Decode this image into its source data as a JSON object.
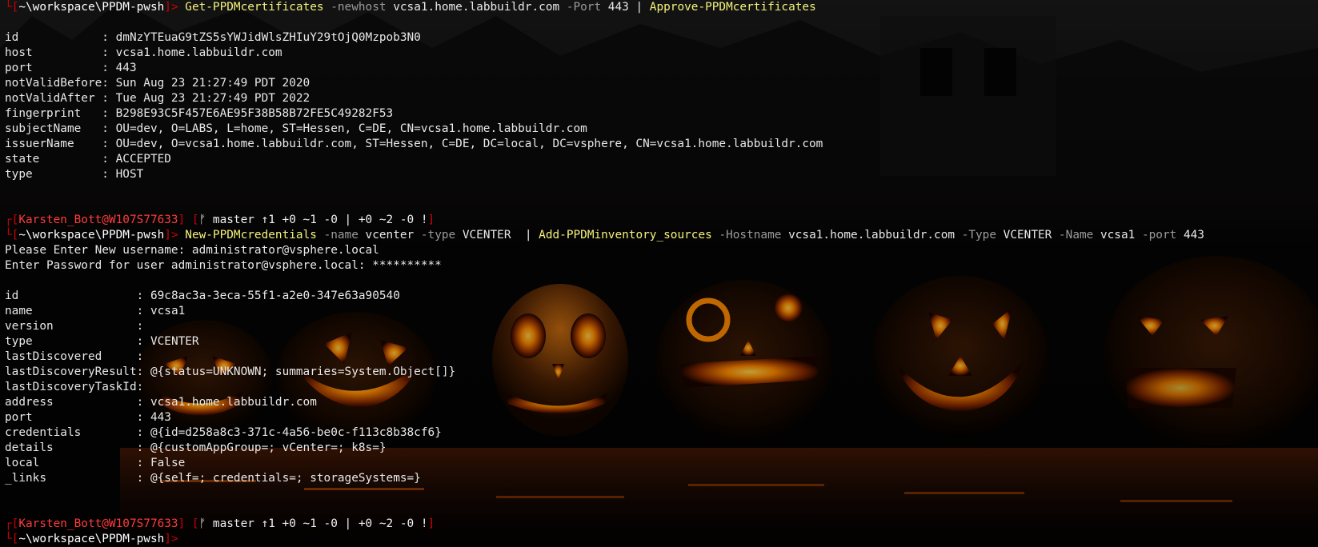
{
  "blocks": [
    {
      "prompt_path": "~\\workspace\\PPDM-pwsh",
      "command": [
        {
          "t": "cmd",
          "v": "Get-PPDMcertificates"
        },
        {
          "t": "param",
          "v": " -newhost"
        },
        {
          "t": "arg",
          "v": " vcsa1.home.labbuildr.com"
        },
        {
          "t": "param",
          "v": " -Port"
        },
        {
          "t": "arg",
          "v": " 443"
        },
        {
          "t": "pipe",
          "v": " | "
        },
        {
          "t": "cmd",
          "v": "Approve-PPDMcertificates"
        }
      ],
      "output": [],
      "props": [
        [
          "id",
          "dmNzYTEuaG9tZS5sYWJidWlsZHIuY29tOjQ0Mzpob3N0"
        ],
        [
          "host",
          "vcsa1.home.labbuildr.com"
        ],
        [
          "port",
          "443"
        ],
        [
          "notValidBefore",
          "Sun Aug 23 21:27:49 PDT 2020"
        ],
        [
          "notValidAfter",
          "Tue Aug 23 21:27:49 PDT 2022"
        ],
        [
          "fingerprint",
          "B298E93C5F457E6AE95F38B58B72FE5C49282F53"
        ],
        [
          "subjectName",
          "OU=dev, O=LABS, L=home, ST=Hessen, C=DE, CN=vcsa1.home.labbuildr.com"
        ],
        [
          "issuerName",
          "OU=dev, O=vcsa1.home.labbuildr.com, ST=Hessen, C=DE, DC=local, DC=vsphere, CN=vcsa1.home.labbuildr.com"
        ],
        [
          "state",
          "ACCEPTED"
        ],
        [
          "type",
          "HOST"
        ]
      ],
      "key_width": 14
    },
    {
      "user_host": "Karsten_Bott@W107S77633",
      "git": "ᚠ master ↑1 +0 ~1 -0 | +0 ~2 -0 !",
      "prompt_path": "~\\workspace\\PPDM-pwsh",
      "command": [
        {
          "t": "cmd",
          "v": "New-PPDMcredentials"
        },
        {
          "t": "param",
          "v": " -name"
        },
        {
          "t": "arg",
          "v": " vcenter"
        },
        {
          "t": "param",
          "v": " -type"
        },
        {
          "t": "arg",
          "v": " VCENTER "
        },
        {
          "t": "pipe",
          "v": " | "
        },
        {
          "t": "cmd",
          "v": "Add-PPDMinventory_sources"
        },
        {
          "t": "param",
          "v": " -Hostname"
        },
        {
          "t": "arg",
          "v": " vcsa1.home.labbuildr.com"
        },
        {
          "t": "param",
          "v": " -Type"
        },
        {
          "t": "arg",
          "v": " VCENTER"
        },
        {
          "t": "param",
          "v": " -Name"
        },
        {
          "t": "arg",
          "v": " vcsa1"
        },
        {
          "t": "param",
          "v": " -port"
        },
        {
          "t": "arg",
          "v": " 443"
        }
      ],
      "output": [
        "Please Enter New username: administrator@vsphere.local",
        "Enter Password for user administrator@vsphere.local: **********"
      ],
      "props": [
        [
          "id",
          "69c8ac3a-3eca-55f1-a2e0-347e63a90540"
        ],
        [
          "name",
          "vcsa1"
        ],
        [
          "version",
          ""
        ],
        [
          "type",
          "VCENTER"
        ],
        [
          "lastDiscovered",
          ""
        ],
        [
          "lastDiscoveryResult",
          "@{status=UNKNOWN; summaries=System.Object[]}"
        ],
        [
          "lastDiscoveryTaskId",
          ""
        ],
        [
          "address",
          "vcsa1.home.labbuildr.com"
        ],
        [
          "port",
          "443"
        ],
        [
          "credentials",
          "@{id=d258a8c3-371c-4a56-be0c-f113c8b38cf6}"
        ],
        [
          "details",
          "@{customAppGroup=; vCenter=; k8s=}"
        ],
        [
          "local",
          "False"
        ],
        [
          "_links",
          "@{self=; credentials=; storageSystems=}"
        ]
      ],
      "key_width": 19
    }
  ],
  "final_prompt": {
    "user_host": "Karsten_Bott@W107S77633",
    "git": "ᚠ master ↑1 +0 ~1 -0 | +0 ~2 -0 !",
    "prompt_path": "~\\workspace\\PPDM-pwsh"
  },
  "colors": {
    "command": "#f5f27a",
    "parameter": "#9a9a9a",
    "prompt_accent": "#d00000",
    "background": "#040303",
    "jack_o_lantern_glow": "#ff8a00"
  }
}
